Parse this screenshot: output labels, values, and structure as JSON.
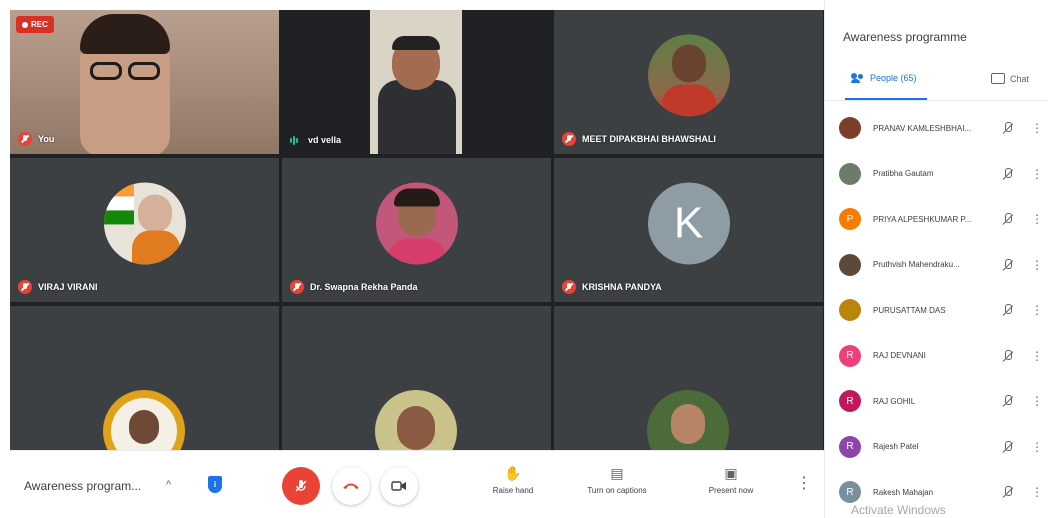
{
  "recording": {
    "label": "REC"
  },
  "tiles": [
    {
      "name": "You",
      "muted": true
    },
    {
      "name": "vd vella",
      "muted": false
    },
    {
      "name": "MEET DIPAKBHAI BHAWSHALI",
      "muted": true
    },
    {
      "name": "VIRAJ VIRANI",
      "muted": true
    },
    {
      "name": "Dr. Swapna Rekha Panda",
      "muted": true
    },
    {
      "name": "KRISHNA PANDYA",
      "muted": true,
      "avatar_letter": "K"
    }
  ],
  "bottom_bar": {
    "meeting_title": "Awareness program...",
    "raise_hand": "Raise hand",
    "captions": "Turn on captions",
    "present": "Present now"
  },
  "panel": {
    "title": "Awareness programme",
    "tab_people": "People (65)",
    "tab_chat": "Chat",
    "participants": [
      {
        "name": "PRANAV KAMLESHBHAI...",
        "initial": "",
        "color": "#7b3f2a"
      },
      {
        "name": "Pratibha Gautam",
        "initial": "",
        "color": "#6d7b6a"
      },
      {
        "name": "PRIYA ALPESHKUMAR P...",
        "initial": "P",
        "color": "#f57c00"
      },
      {
        "name": "Pruthvish Mahendraku...",
        "initial": "",
        "color": "#5b4a3a"
      },
      {
        "name": "PURUSATTAM DAS",
        "initial": "",
        "color": "#b8860b"
      },
      {
        "name": "RAJ DEVNANI",
        "initial": "R",
        "color": "#ec407a"
      },
      {
        "name": "RAJ GOHIL",
        "initial": "R",
        "color": "#c2185b"
      },
      {
        "name": "Rajesh Patel",
        "initial": "R",
        "color": "#8e44ad"
      },
      {
        "name": "Rakesh Mahajan",
        "initial": "R",
        "color": "#78909c"
      }
    ]
  },
  "watermark": "Activate Windows"
}
